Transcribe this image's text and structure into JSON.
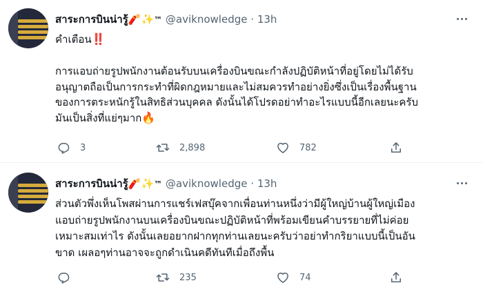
{
  "tweets": [
    {
      "author_name": "สาระการบินน่ารู้",
      "author_emoji": "🧨",
      "author_sparkle": "✨",
      "author_tm": "™",
      "handle": "@aviknowledge",
      "separator": "·",
      "time": "13h",
      "warning_text": "คำเตือน",
      "warning_emoji": "‼️",
      "lines": [
        "การแอบถ่ายรูปพนักงานต้อนรับบนเครื่องบินขณะกำลังปฏิบัติหน้าที่อยู่โดยไม่ได้รับ",
        "อนุญาตถือเป็นการกระทำที่ผิดกฎหมายและไม่สมควรทำอย่างยิ่งซึ่งเป็นเรื่องพื้นฐาน",
        "ของการตระหนักรู้ในสิทธิส่วนบุคคล ดังนั้นได้โปรดอย่าทำอะไรแบบนี้อีกเลยนะครับ",
        "มันเป็นสิ่งที่แย่ๆมาก"
      ],
      "end_emoji": "🔥",
      "replies": "3",
      "retweets": "2,898",
      "likes": "782"
    },
    {
      "author_name": "สาระการบินน่ารู้",
      "author_emoji": "🧨",
      "author_sparkle": "✨",
      "author_tm": "™",
      "handle": "@aviknowledge",
      "separator": "·",
      "time": "13h",
      "lines": [
        "ส่วนตัวพึ่งเห็นโพสผ่านการแชร์เฟสบุ๊คจากเพื่อนท่านหนึ่งว่ามีผู้ใหญ่บ้านผู้ใหญ่เมือง",
        "แอบถ่ายรูปพนักงานบนเครื่องบินขณะปฏิบัติหน้าที่พร้อมเขียนคำบรรยายที่ไม่ค่อย",
        "เหมาะสมเท่าไร ดังนั้นเลยอยากฝากทุกท่านเลยนะครับว่าอย่าทำกริยาแบบนี้เป็นอัน",
        "ขาด เผลอๆท่านอาจจะถูกดำเนินคดีทันทีเมื่อถึงพื้น"
      ],
      "replies": "",
      "retweets": "235",
      "likes": "74"
    }
  ],
  "colors": {
    "text": "#0f1419",
    "muted": "#536471",
    "divider": "#eff3f4",
    "gold": "#d6ab3c"
  },
  "icons": [
    "reply-icon",
    "retweet-icon",
    "like-icon",
    "share-icon",
    "more-icon"
  ]
}
